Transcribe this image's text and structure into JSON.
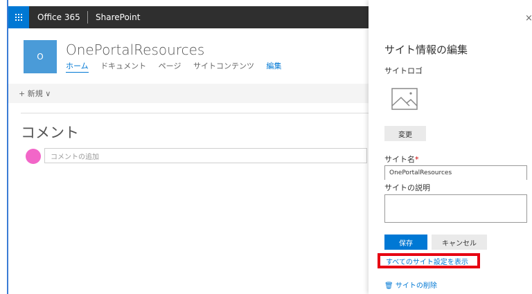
{
  "topbar": {
    "app_name": "Office 365",
    "product": "SharePoint"
  },
  "site": {
    "logo_text": "O",
    "title": "OnePortalResources",
    "nav": [
      "ホーム",
      "ドキュメント",
      "ページ",
      "サイトコンテンツ"
    ],
    "nav_edit": "編集"
  },
  "command_bar": {
    "new_label": "+ 新規 ∨"
  },
  "comments": {
    "title": "コメント",
    "placeholder": "コメントの追加"
  },
  "panel": {
    "close": "×",
    "title": "サイト情報の編集",
    "logo_label": "サイトロゴ",
    "change_button": "変更",
    "name_label": "サイト名",
    "required_mark": "*",
    "name_value": "OnePortalResources",
    "description_label": "サイトの説明",
    "save_button": "保存",
    "cancel_button": "キャンセル",
    "all_settings_link": "すべてのサイト設定を表示",
    "delete_link": "🗑 サイトの削除"
  },
  "colors": {
    "accent": "#0078d4",
    "highlight": "#e60012",
    "logo_bg": "#4a9bd8",
    "avatar": "#f266c8"
  }
}
